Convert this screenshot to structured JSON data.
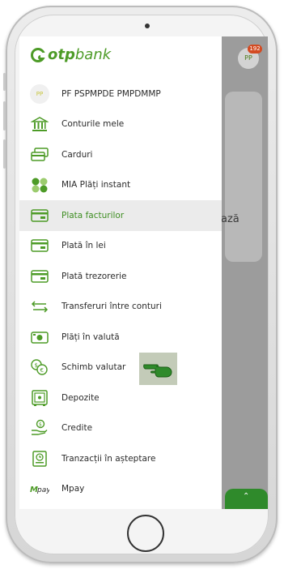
{
  "profile": {
    "initials": "PP",
    "name": "PF PSPMPDE PMPDMMP"
  },
  "logo": {
    "part1": "otp",
    "part2": "bank"
  },
  "menu": {
    "items": [
      {
        "label": "Conturile mele",
        "icon": "bank-building-icon"
      },
      {
        "label": "Carduri",
        "icon": "cards-icon"
      },
      {
        "label": "MIA Plăți instant",
        "icon": "mia-dots-icon"
      },
      {
        "label": "Plata facturilor",
        "icon": "bill-payment-icon",
        "active": true
      },
      {
        "label": "Plată în lei",
        "icon": "lei-payment-icon"
      },
      {
        "label": "Plată trezorerie",
        "icon": "treasury-payment-icon"
      },
      {
        "label": "Transferuri între conturi",
        "icon": "transfer-arrows-icon"
      },
      {
        "label": "Plăți în valută",
        "icon": "currency-payment-icon"
      },
      {
        "label": "Schimb valutar",
        "icon": "currency-exchange-icon"
      },
      {
        "label": "Depozite",
        "icon": "safe-deposit-icon"
      },
      {
        "label": "Credite",
        "icon": "credit-hand-icon"
      },
      {
        "label": "Tranzacții în așteptare",
        "icon": "pending-transactions-icon"
      },
      {
        "label": "Mpay",
        "icon": "mpay-logo-icon"
      }
    ]
  },
  "background": {
    "avatar_initials": "PP",
    "badge_count": "192",
    "partial_text": "ază"
  },
  "colors": {
    "brand": "#4d9b27",
    "active_text": "#3e8e22",
    "active_bg": "#ebebeb",
    "overlay": "#9c9c9c",
    "badge": "#d34b22"
  }
}
